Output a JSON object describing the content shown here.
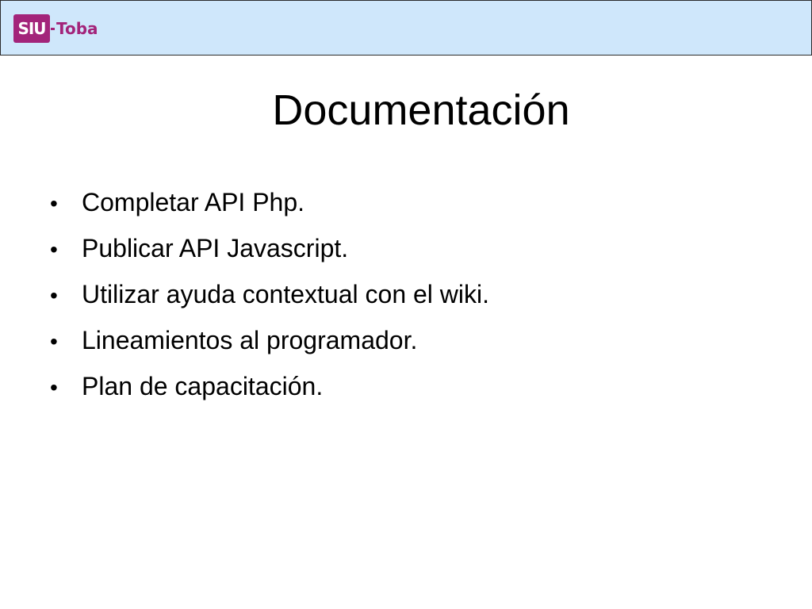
{
  "header": {
    "logo_badge": "SIU",
    "logo_text": "Toba"
  },
  "slide": {
    "title": "Documentación",
    "bullets": [
      "Completar API Php.",
      "Publicar API Javascript.",
      "Utilizar ayuda contextual con el wiki.",
      "Lineamientos al programador.",
      "Plan de capacitación."
    ]
  },
  "colors": {
    "header_background": "#cfe7fb",
    "brand": "#a3247a",
    "text": "#000000"
  },
  "icons": {
    "bullet": "bullet-icon",
    "logo": "siu-logo-icon"
  }
}
